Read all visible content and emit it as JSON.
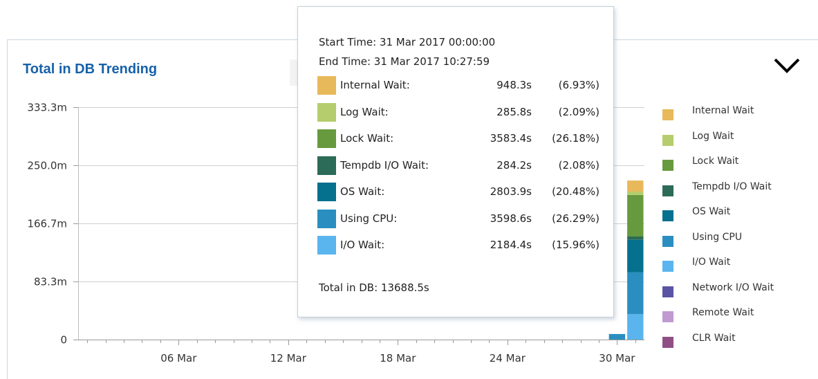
{
  "widget": {
    "title": "Total in DB Trending",
    "expand_icon": "chevron-down-icon"
  },
  "chart_data": {
    "type": "bar",
    "stacked": true,
    "title": "Total in DB Trending",
    "xlabel": "",
    "ylabel": "",
    "ylim": [
      0,
      333.3
    ],
    "y_ticks": [
      "0",
      "83.3m",
      "166.7m",
      "250.0m",
      "333.3m"
    ],
    "y_tick_values": [
      0,
      83.3,
      166.7,
      250.0,
      333.3
    ],
    "x_ticks": [
      "06 Mar",
      "12 Mar",
      "18 Mar",
      "24 Mar",
      "30 Mar"
    ],
    "x_tick_days": [
      6,
      12,
      18,
      24,
      30
    ],
    "x_range_days": [
      1,
      31
    ],
    "grid": true,
    "legend_position": "right",
    "bars": [
      {
        "x_day": 30,
        "segments": [
          {
            "series": "Using CPU",
            "value": 8
          }
        ]
      },
      {
        "x_day": 31,
        "segments": [
          {
            "series": "I/O Wait",
            "value": 36.4
          },
          {
            "series": "Using CPU",
            "value": 60.0
          },
          {
            "series": "OS Wait",
            "value": 46.7
          },
          {
            "series": "Tempdb I/O Wait",
            "value": 4.7
          },
          {
            "series": "Lock Wait",
            "value": 59.7
          },
          {
            "series": "Log Wait",
            "value": 4.8
          },
          {
            "series": "Internal Wait",
            "value": 15.8
          }
        ]
      }
    ],
    "series": [
      {
        "name": "Internal Wait",
        "color": "#e8b95a"
      },
      {
        "name": "Log Wait",
        "color": "#b5cd6d"
      },
      {
        "name": "Lock Wait",
        "color": "#679a3e"
      },
      {
        "name": "Tempdb I/O Wait",
        "color": "#2c6b57"
      },
      {
        "name": "OS Wait",
        "color": "#06708f"
      },
      {
        "name": "Using CPU",
        "color": "#2a8fc0"
      },
      {
        "name": "I/O Wait",
        "color": "#5ab5ee"
      },
      {
        "name": "Network I/O Wait",
        "color": "#5a54a5"
      },
      {
        "name": "Remote Wait",
        "color": "#c09ad1"
      },
      {
        "name": "CLR Wait",
        "color": "#8f4f85"
      }
    ]
  },
  "legend": [
    "Internal Wait",
    "Log Wait",
    "Lock Wait",
    "Tempdb I/O Wait",
    "OS Wait",
    "Using CPU",
    "I/O Wait",
    "Network I/O Wait",
    "Remote Wait",
    "CLR Wait"
  ],
  "tooltip": {
    "start_time": "Start Time: 31 Mar 2017 00:00:00",
    "end_time": "End Time: 31 Mar 2017 10:27:59",
    "rows": [
      {
        "name": "Internal Wait:",
        "value": "948.3s",
        "pct": "(6.93%)",
        "color": "#e8b95a"
      },
      {
        "name": "Log Wait:",
        "value": "285.8s",
        "pct": "(2.09%)",
        "color": "#b5cd6d"
      },
      {
        "name": "Lock Wait:",
        "value": "3583.4s",
        "pct": "(26.18%)",
        "color": "#679a3e"
      },
      {
        "name": "Tempdb I/O Wait:",
        "value": "284.2s",
        "pct": "(2.08%)",
        "color": "#2c6b57"
      },
      {
        "name": "OS Wait:",
        "value": "2803.9s",
        "pct": "(20.48%)",
        "color": "#06708f"
      },
      {
        "name": "Using CPU:",
        "value": "3598.6s",
        "pct": "(26.29%)",
        "color": "#2a8fc0"
      },
      {
        "name": "I/O Wait:",
        "value": "2184.4s",
        "pct": "(15.96%)",
        "color": "#5ab5ee"
      }
    ],
    "total": "Total in DB: 13688.5s"
  }
}
